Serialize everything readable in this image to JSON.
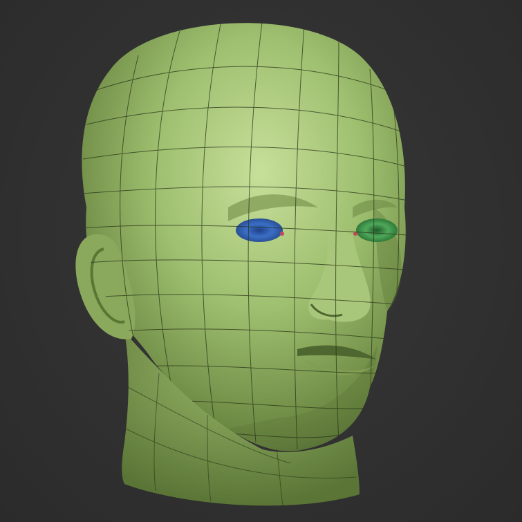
{
  "scene": {
    "subject": "head-sculpt",
    "colors": {
      "background": "#313131",
      "skin": "#9fc070",
      "skin_shadow": "#5f7a3a",
      "skin_highlight": "#c7df9a",
      "wire": "#2a3418",
      "eye_left": "#3a6fc6",
      "eye_right": "#4fa85a",
      "tear_duct": "#c04a5a"
    },
    "icons": [
      "head-model",
      "wireframe-overlay",
      "left-eye",
      "right-eye",
      "ear"
    ]
  }
}
